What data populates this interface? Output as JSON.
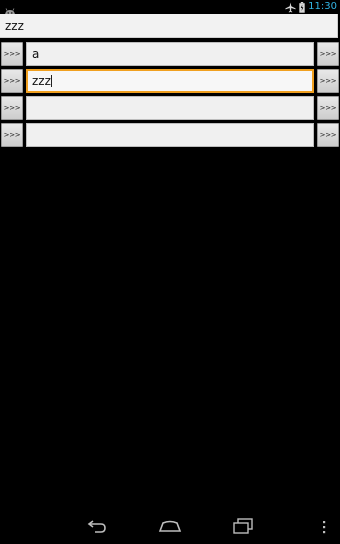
{
  "status_bar": {
    "time": "11:30",
    "icons": [
      "android-notification-icon",
      "airplane-mode-icon",
      "battery-icon"
    ],
    "clock_color": "#33b5e5"
  },
  "top_field": {
    "value": "zzz"
  },
  "rows": [
    {
      "left_button": ">>>",
      "value": "a",
      "right_button": ">>>",
      "focused": false
    },
    {
      "left_button": ">>>",
      "value": "zzz",
      "right_button": ">>>",
      "focused": true
    },
    {
      "left_button": ">>>",
      "value": "",
      "right_button": ">>>",
      "focused": false
    },
    {
      "left_button": ">>>",
      "value": "",
      "right_button": ">>>",
      "focused": false
    }
  ],
  "focus_color": "#f0a020",
  "nav_bar": {
    "icons": [
      "back-icon",
      "home-icon",
      "recent-apps-icon",
      "overflow-menu-icon"
    ]
  }
}
